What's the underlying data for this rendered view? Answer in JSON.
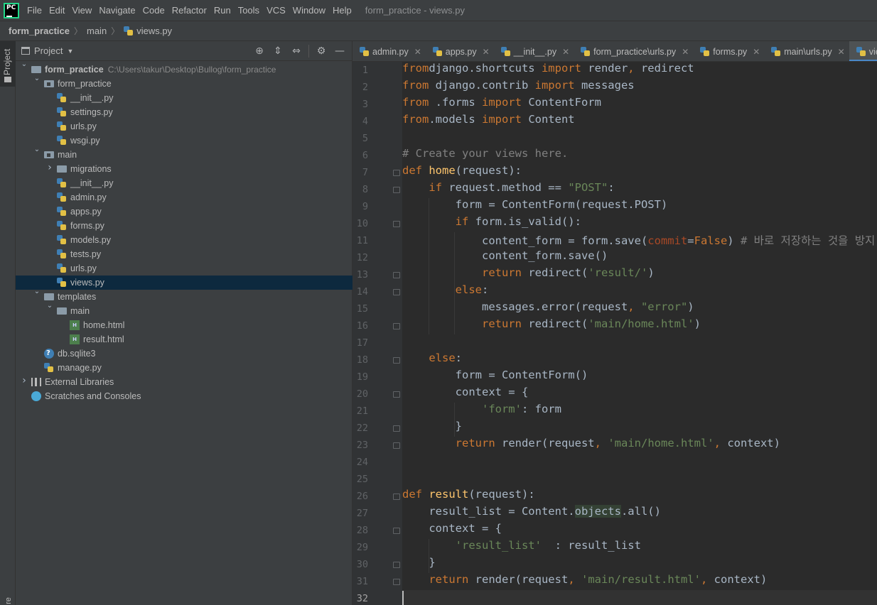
{
  "app": {
    "logo_text": "PC",
    "window_title": "form_practice - views.py"
  },
  "menu": [
    "File",
    "Edit",
    "View",
    "Navigate",
    "Code",
    "Refactor",
    "Run",
    "Tools",
    "VCS",
    "Window",
    "Help"
  ],
  "breadcrumb": [
    "form_practice",
    "main",
    "views.py"
  ],
  "left_stripe": {
    "project_label": "Project",
    "bottom_label": "re"
  },
  "project_panel": {
    "title": "Project",
    "tool_icons": [
      "locate-icon",
      "expand-all-icon",
      "collapse-all-icon",
      "gear-icon",
      "hide-icon"
    ],
    "tree": [
      {
        "label": "form_practice",
        "path": "C:\\Users\\takur\\Desktop\\Bullog\\form_practice",
        "icon": "folder",
        "level": 0,
        "arrow": "down",
        "bold": true
      },
      {
        "label": "form_practice",
        "icon": "module",
        "level": 1,
        "arrow": "down"
      },
      {
        "label": "__init__.py",
        "icon": "python",
        "level": 2
      },
      {
        "label": "settings.py",
        "icon": "python",
        "level": 2
      },
      {
        "label": "urls.py",
        "icon": "python",
        "level": 2
      },
      {
        "label": "wsgi.py",
        "icon": "python",
        "level": 2
      },
      {
        "label": "main",
        "icon": "module",
        "level": 1,
        "arrow": "down"
      },
      {
        "label": "migrations",
        "icon": "folder",
        "level": 2,
        "arrow": "right"
      },
      {
        "label": "__init__.py",
        "icon": "python",
        "level": 2
      },
      {
        "label": "admin.py",
        "icon": "python",
        "level": 2
      },
      {
        "label": "apps.py",
        "icon": "python",
        "level": 2
      },
      {
        "label": "forms.py",
        "icon": "python",
        "level": 2
      },
      {
        "label": "models.py",
        "icon": "python",
        "level": 2
      },
      {
        "label": "tests.py",
        "icon": "python",
        "level": 2
      },
      {
        "label": "urls.py",
        "icon": "python",
        "level": 2
      },
      {
        "label": "views.py",
        "icon": "python",
        "level": 2,
        "selected": true
      },
      {
        "label": "templates",
        "icon": "folder",
        "level": 1,
        "arrow": "down"
      },
      {
        "label": "main",
        "icon": "folder",
        "level": 2,
        "arrow": "down"
      },
      {
        "label": "home.html",
        "icon": "html",
        "level": 3
      },
      {
        "label": "result.html",
        "icon": "html",
        "level": 3
      },
      {
        "label": "db.sqlite3",
        "icon": "db",
        "level": 1
      },
      {
        "label": "manage.py",
        "icon": "python",
        "level": 1
      },
      {
        "label": "External Libraries",
        "icon": "library",
        "level": 0,
        "arrow": "right"
      },
      {
        "label": "Scratches and Consoles",
        "icon": "scratch",
        "level": 0
      }
    ]
  },
  "tabs": [
    {
      "label": "admin.py"
    },
    {
      "label": "apps.py"
    },
    {
      "label": "__init__.py"
    },
    {
      "label": "form_practice\\urls.py"
    },
    {
      "label": "forms.py"
    },
    {
      "label": "main\\urls.py"
    },
    {
      "label": "views.py",
      "active": true
    }
  ],
  "code": {
    "current_line": 32,
    "lines": [
      {
        "n": "1",
        "t": [
          [
            "kw",
            "from"
          ],
          [
            "",
            "django.shortcuts "
          ],
          [
            "kw",
            "import"
          ],
          [
            "",
            " render"
          ],
          [
            "kw",
            ","
          ],
          [
            "",
            " redirect"
          ]
        ]
      },
      {
        "n": "2",
        "t": [
          [
            "kw",
            "from"
          ],
          [
            "",
            " django.contrib "
          ],
          [
            "kw",
            "import"
          ],
          [
            "",
            " messages"
          ]
        ]
      },
      {
        "n": "3",
        "t": [
          [
            "kw",
            "from"
          ],
          [
            "",
            " .forms "
          ],
          [
            "kw",
            "import"
          ],
          [
            "",
            " ContentForm"
          ]
        ]
      },
      {
        "n": "4",
        "t": [
          [
            "kw",
            "from"
          ],
          [
            "",
            ".models "
          ],
          [
            "kw",
            "import"
          ],
          [
            "",
            " Content"
          ]
        ]
      },
      {
        "n": "5",
        "t": []
      },
      {
        "n": "6",
        "t": [
          [
            "cm",
            "# Create your views here."
          ]
        ]
      },
      {
        "n": "7",
        "t": [
          [
            "kw",
            "def"
          ],
          [
            "",
            " "
          ],
          [
            "fn",
            "home"
          ],
          [
            "",
            "(request):"
          ]
        ]
      },
      {
        "n": "8",
        "t": [
          [
            "",
            "    "
          ],
          [
            "kw",
            "if"
          ],
          [
            "",
            " request.method == "
          ],
          [
            "st",
            "\"POST\""
          ],
          [
            "",
            ":"
          ]
        ]
      },
      {
        "n": "9",
        "t": [
          [
            "",
            "        form = ContentForm(request.POST)"
          ]
        ]
      },
      {
        "n": "10",
        "t": [
          [
            "",
            "        "
          ],
          [
            "kw",
            "if"
          ],
          [
            "",
            " form.is_valid():"
          ]
        ]
      },
      {
        "n": "11",
        "t": [
          [
            "",
            "            content_form = form.save("
          ],
          [
            "pm",
            "commit"
          ],
          [
            "",
            "="
          ],
          [
            "kw",
            "False"
          ],
          [
            "",
            ")"
          ],
          [
            "cm",
            " # 바로 저장하는 것을 방지"
          ]
        ]
      },
      {
        "n": "12",
        "t": [
          [
            "",
            "            content_form.save()"
          ]
        ]
      },
      {
        "n": "13",
        "t": [
          [
            "",
            "            "
          ],
          [
            "kw",
            "return"
          ],
          [
            "",
            " redirect("
          ],
          [
            "st",
            "'result/'"
          ],
          [
            "",
            ")"
          ]
        ]
      },
      {
        "n": "14",
        "t": [
          [
            "",
            "        "
          ],
          [
            "kw",
            "else"
          ],
          [
            "",
            ":"
          ]
        ]
      },
      {
        "n": "15",
        "t": [
          [
            "",
            "            messages.error(request"
          ],
          [
            "kw",
            ","
          ],
          [
            "",
            " "
          ],
          [
            "st",
            "\"error\""
          ],
          [
            "",
            ")"
          ]
        ]
      },
      {
        "n": "16",
        "t": [
          [
            "",
            "            "
          ],
          [
            "kw",
            "return"
          ],
          [
            "",
            " redirect("
          ],
          [
            "st",
            "'main/home.html'"
          ],
          [
            "",
            ")"
          ]
        ]
      },
      {
        "n": "17",
        "t": []
      },
      {
        "n": "18",
        "t": [
          [
            "",
            "    "
          ],
          [
            "kw",
            "else"
          ],
          [
            "",
            ":"
          ]
        ]
      },
      {
        "n": "19",
        "t": [
          [
            "",
            "        form = ContentForm()"
          ]
        ]
      },
      {
        "n": "20",
        "t": [
          [
            "",
            "        context = {"
          ]
        ]
      },
      {
        "n": "21",
        "t": [
          [
            "",
            "            "
          ],
          [
            "st",
            "'form'"
          ],
          [
            "",
            ": form"
          ]
        ]
      },
      {
        "n": "22",
        "t": [
          [
            "",
            "        }"
          ]
        ]
      },
      {
        "n": "23",
        "t": [
          [
            "",
            "        "
          ],
          [
            "kw",
            "return"
          ],
          [
            "",
            " render(request"
          ],
          [
            "kw",
            ","
          ],
          [
            "",
            " "
          ],
          [
            "st",
            "'main/home.html'"
          ],
          [
            "kw",
            ","
          ],
          [
            "",
            " context)"
          ]
        ]
      },
      {
        "n": "24",
        "t": []
      },
      {
        "n": "25",
        "t": []
      },
      {
        "n": "26",
        "t": [
          [
            "kw",
            "def"
          ],
          [
            "",
            " "
          ],
          [
            "fn",
            "result"
          ],
          [
            "",
            "(request):"
          ]
        ]
      },
      {
        "n": "27",
        "t": [
          [
            "",
            "    result_list = Content."
          ],
          [
            "hl",
            "objects"
          ],
          [
            "",
            ".all()"
          ]
        ]
      },
      {
        "n": "28",
        "t": [
          [
            "",
            "    context = {"
          ]
        ]
      },
      {
        "n": "29",
        "t": [
          [
            "",
            "        "
          ],
          [
            "st",
            "'result_list'"
          ],
          [
            "",
            "  : result_list"
          ]
        ]
      },
      {
        "n": "30",
        "t": [
          [
            "",
            "    }"
          ]
        ]
      },
      {
        "n": "31",
        "t": [
          [
            "",
            "    "
          ],
          [
            "kw",
            "return"
          ],
          [
            "",
            " render(request"
          ],
          [
            "kw",
            ","
          ],
          [
            "",
            " "
          ],
          [
            "st",
            "'main/result.html'"
          ],
          [
            "kw",
            ","
          ],
          [
            "",
            " context)"
          ]
        ]
      },
      {
        "n": "32",
        "t": []
      }
    ]
  }
}
